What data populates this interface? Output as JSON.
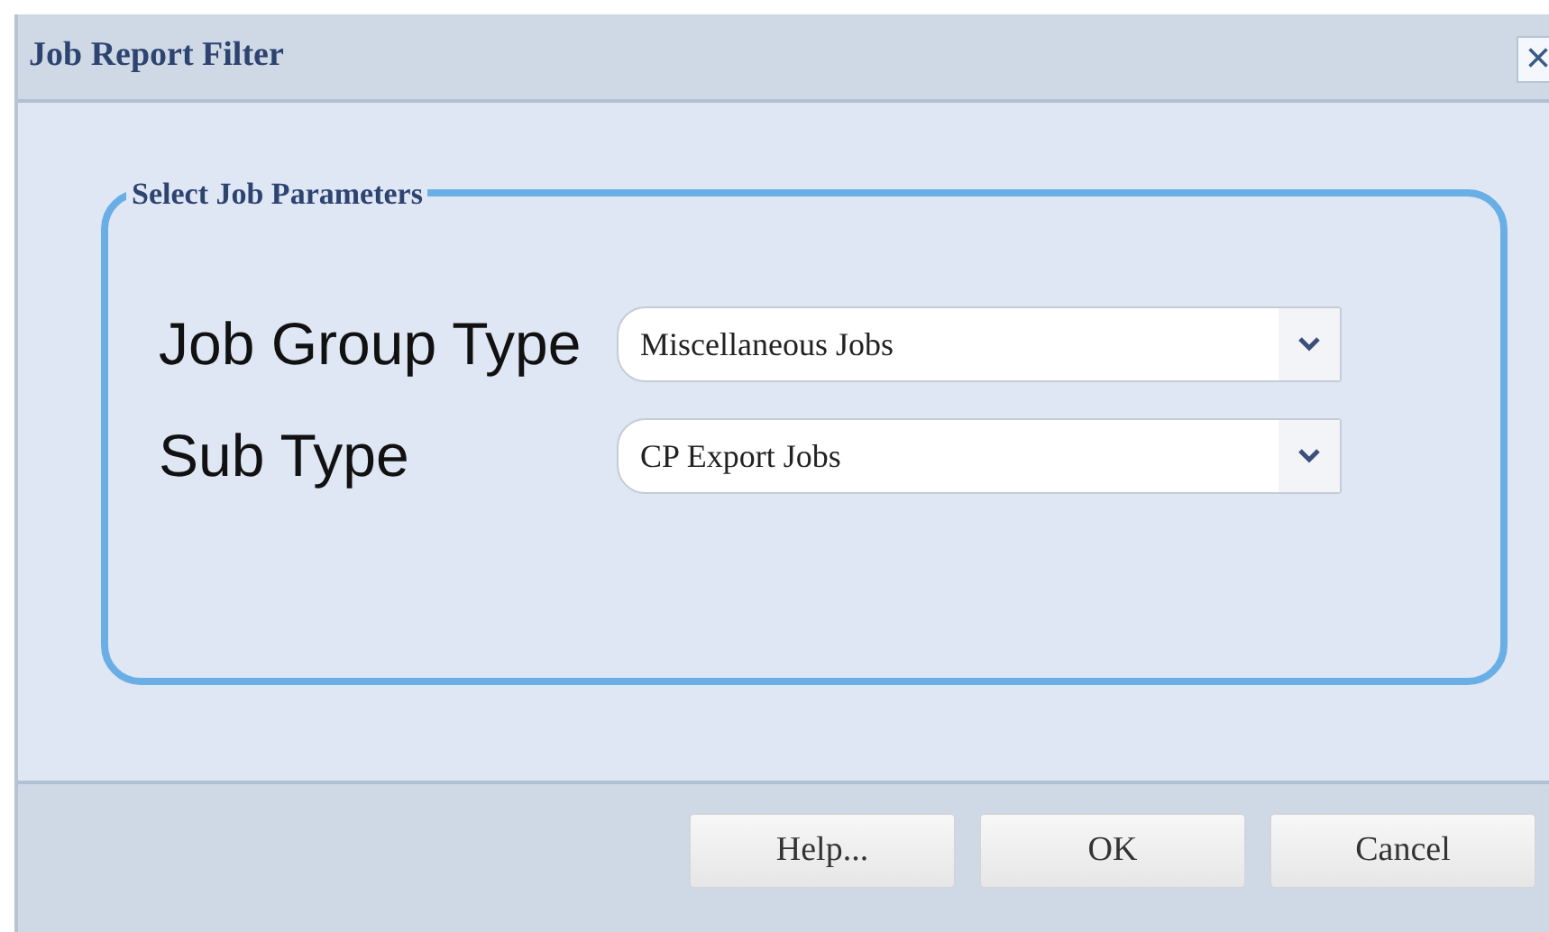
{
  "window": {
    "title": "Job Report Filter",
    "close": "×"
  },
  "group": {
    "legend": "Select Job Parameters",
    "fields": [
      {
        "label": "Job Group Type",
        "value": "Miscellaneous Jobs"
      },
      {
        "label": "Sub Type",
        "value": "CP Export Jobs"
      }
    ]
  },
  "buttons": [
    "Help...",
    "OK",
    "Cancel"
  ]
}
